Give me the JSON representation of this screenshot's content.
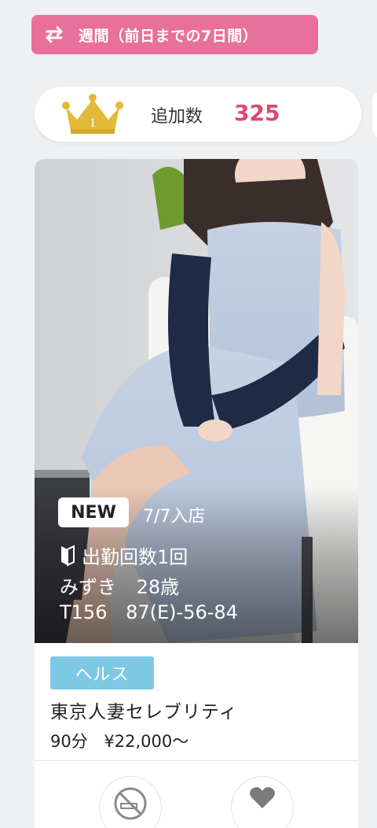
{
  "ranking": {
    "period_label": "週間（前日までの7日間）",
    "period_icon": "swap-arrows-icon",
    "rank": "1",
    "metric_label": "追加数",
    "metric_value": "325",
    "accent_color": "#e9709a",
    "value_color": "#e0486f"
  },
  "card": {
    "new_badge": "NEW",
    "join_date": "7/7入店",
    "attendance_icon": "beginner-mark-icon",
    "attendance": "出勤回数1回",
    "name": "みずき",
    "age": "28歳",
    "height": "T156",
    "measurements": "87(E)-56-84",
    "genre": "ヘルス",
    "genre_color": "#7dc8e4",
    "shop_name": "東京人妻セレブリティ",
    "duration": "90分",
    "price": "¥22,000〜",
    "actions": [
      {
        "icon": "no-smoking-icon"
      },
      {
        "icon": "heart-icon"
      }
    ]
  }
}
